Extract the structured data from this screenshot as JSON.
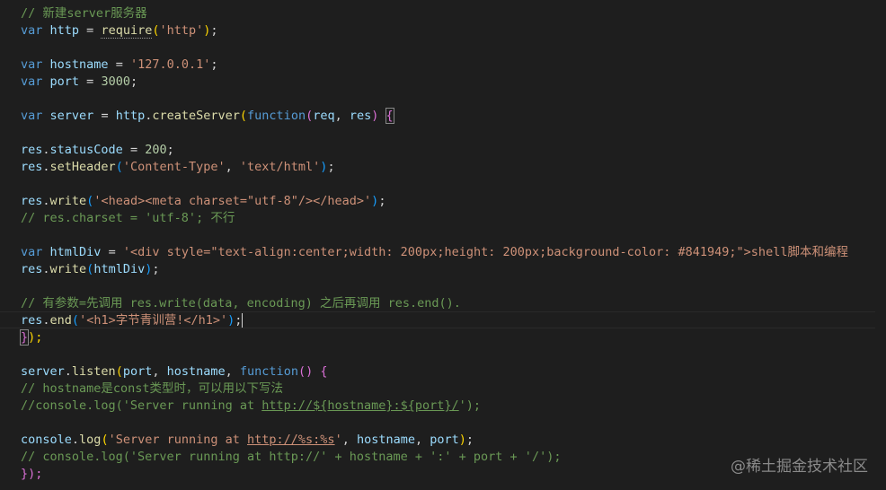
{
  "editor": {
    "lines": {
      "l1": {
        "comment": "// 新建server服务器"
      },
      "l2": {
        "kw": "var",
        "name": "http",
        "op": " = ",
        "fn": "require",
        "arg": "'http'",
        "end": ";"
      },
      "l3": {
        "kw": "var",
        "name": "hostname",
        "op": " = ",
        "str": "'127.0.0.1'",
        "end": ";"
      },
      "l4": {
        "kw": "var",
        "name": "port",
        "op": " = ",
        "num": "3000",
        "end": ";"
      },
      "l5": {
        "kw": "var",
        "name": "server",
        "op": " = ",
        "obj": "http",
        "dot": ".",
        "fn": "createServer",
        "kw2": "function",
        "p1": "req",
        "comma": ", ",
        "p2": "res"
      },
      "l6": {
        "obj": "res",
        "dot": ".",
        "prop": "statusCode",
        "op": " = ",
        "num": "200",
        "end": ";"
      },
      "l7": {
        "obj": "res",
        "dot": ".",
        "fn": "setHeader",
        "s1": "'Content-Type'",
        "comma": ", ",
        "s2": "'text/html'",
        "end": ";"
      },
      "l8": {
        "obj": "res",
        "dot": ".",
        "fn": "write",
        "str": "'<head><meta charset=\"utf-8\"/></head>'",
        "end": ";"
      },
      "l9": {
        "comment": "// res.charset = 'utf-8'; 不行"
      },
      "l10": {
        "kw": "var",
        "name": "htmlDiv",
        "op": " = ",
        "str": "'<div style=\"text-align:center;width: 200px;height: 200px;background-color: #841949;\">shell脚本和编程"
      },
      "l11": {
        "obj": "res",
        "dot": ".",
        "fn": "write",
        "arg": "htmlDiv",
        "end": ";"
      },
      "l12": {
        "comment": "// 有参数=先调用 res.write(data, encoding) 之后再调用 res.end()."
      },
      "l13": {
        "obj": "res",
        "dot": ".",
        "fn": "end",
        "str": "'<h1>字节青训营!</h1>'",
        "end": ";"
      },
      "l14": {
        "close": "}",
        "rest": ");"
      },
      "l15": {
        "obj": "server",
        "dot": ".",
        "fn": "listen",
        "a1": "port",
        "comma": ", ",
        "a2": "hostname",
        "comma2": ", ",
        "kw": "function",
        "rest": " {"
      },
      "l16": {
        "comment": "// hostname是const类型时，可以用以下写法"
      },
      "l17": {
        "pre": "//console.log('Server running at ",
        "url": "http://${hostname}:${port}/",
        "post": "');"
      },
      "l18": {
        "obj": "console",
        "dot": ".",
        "fn": "log",
        "s1a": "'Server running at ",
        "url": "http://%s:%s",
        "s1b": "'",
        "comma": ", ",
        "a1": "hostname",
        "comma2": ", ",
        "a2": "port",
        "end": ";"
      },
      "l19": {
        "comment": "// console.log('Server running at http://' + hostname + ':' + port + '/');"
      },
      "l20": {
        "text": "});"
      }
    },
    "watermark": "@稀土掘金技术社区"
  }
}
